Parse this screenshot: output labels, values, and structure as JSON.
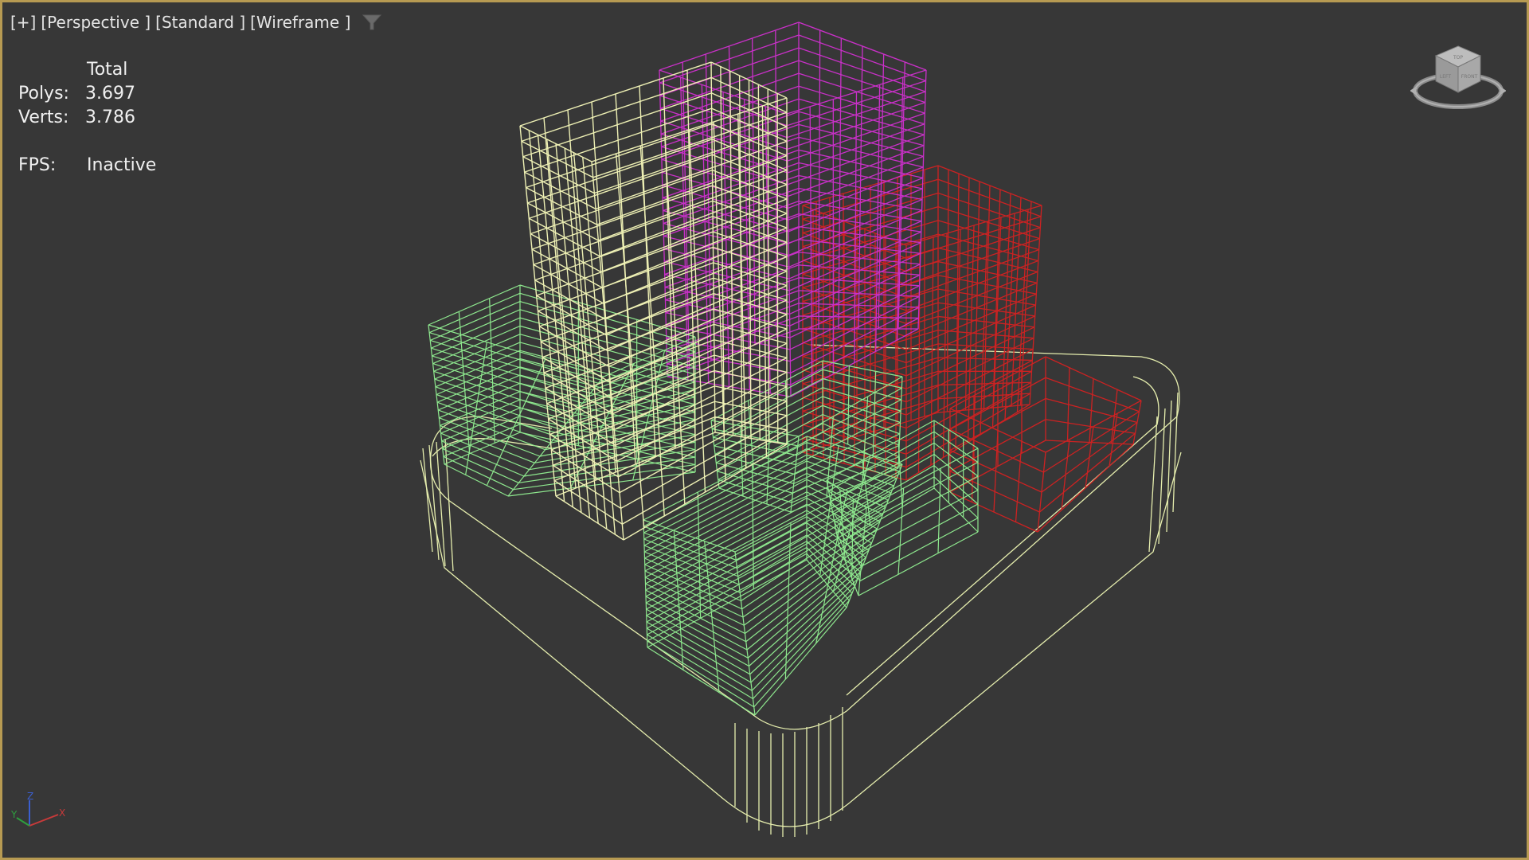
{
  "viewport": {
    "labels": [
      "[+]",
      "[Perspective ]",
      "[Standard ]",
      "[Wireframe ]"
    ],
    "filter_icon": "funnel-icon"
  },
  "stats": {
    "header": "Total",
    "polys_label": "Polys:",
    "polys_value": "3.697",
    "verts_label": "Verts:",
    "verts_value": "3.786",
    "fps_label": "FPS:",
    "fps_value": "Inactive"
  },
  "viewcube": {
    "icon": "viewcube-icon",
    "faces": [
      "TOP",
      "LEFT",
      "FRONT"
    ]
  },
  "axis_tripod": {
    "icon": "axis-tripod-icon",
    "axes": [
      "X",
      "Y",
      "Z"
    ]
  },
  "colors": {
    "background": "#373737",
    "border": "#b79a52",
    "base_wire": "#e6eeae",
    "white_tower": "#eef0b4",
    "magenta_tower": "#c930c8",
    "red_block": "#cc2222",
    "green_blocks": "#8ee88e"
  }
}
